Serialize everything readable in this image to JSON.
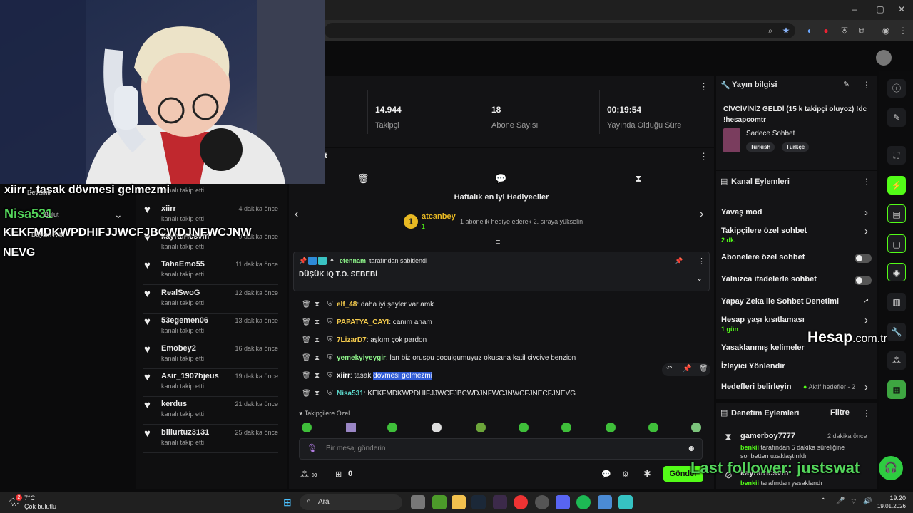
{
  "browser": {
    "window_controls": [
      "–",
      "▢",
      "✕"
    ],
    "ext_icons": [
      "zoom-icon",
      "star-icon",
      "ext-icon-1",
      "ext-icon-2",
      "shield-icon",
      "puzzle-icon",
      "profile-icon",
      "menu-icon"
    ]
  },
  "stats": [
    {
      "value": "14.944",
      "label": "Takipçi"
    },
    {
      "value": "18",
      "label": "Abone Sayısı"
    },
    {
      "value": "00:19:54",
      "label": "Yayında Olduğu Süre"
    }
  ],
  "chat_header": {
    "title_fragment": "et"
  },
  "top_gifters": {
    "title": "Haftalık en iyi Hediyeciler",
    "rank": "1",
    "name": "atcanbey",
    "count": "1",
    "hint": "1 abonelik hediye ederek 2. sıraya yükselin"
  },
  "pinned": {
    "by_user": "etennam",
    "by_text": "tarafından sabitlendi",
    "message": "DÜŞÜK IQ T.O. SEBEBİ"
  },
  "messages": [
    {
      "user": "elf_48",
      "color": "#f2c94c",
      "text": "daha iyi şeyler var amk"
    },
    {
      "user": "PAPATYA_CAYI",
      "color": "#f2c94c",
      "text": "canım anam"
    },
    {
      "user": "7LizarD7",
      "color": "#f2c94c",
      "text": "aşkım çok pardon"
    },
    {
      "user": "yemekyiyeygir",
      "color": "#8ef58a",
      "text": "lan biz oruspu cocuigumuyuz okusana katil civcive benzion"
    },
    {
      "user": "xiirr",
      "color": "#ffffff",
      "text": "tasak ",
      "highlight": "dövmesi gelmezmi"
    },
    {
      "user": "Nisa531",
      "color": "#5bd6c9",
      "text": "KEKFMDKWPDHIFJJWCFJBCWDJNFWCJNWCFJNECFJNEVG"
    }
  ],
  "followers_only": "Takipçilere Özel",
  "chat_input": {
    "placeholder": "Bir mesaj gönderin",
    "send": "Gönder",
    "points": "0"
  },
  "followers": [
    {
      "name": "xiirr",
      "sub": "kanalı takip etti",
      "time": "4 dakika önce"
    },
    {
      "name": "kayralricsvm",
      "sub": "kanalı takip etti",
      "time": "9 dakika önce"
    },
    {
      "name": "TahaEmo55",
      "sub": "kanalı takip etti",
      "time": "11 dakika önce"
    },
    {
      "name": "RealSwoG",
      "sub": "kanalı takip etti",
      "time": "12 dakika önce"
    },
    {
      "name": "53egemen06",
      "sub": "kanalı takip etti",
      "time": "13 dakika önce"
    },
    {
      "name": "Emobey2",
      "sub": "kanalı takip etti",
      "time": "16 dakika önce"
    },
    {
      "name": "Asir_1907bjeus",
      "sub": "kanalı takip etti",
      "time": "19 dakika önce"
    },
    {
      "name": "kerdus",
      "sub": "kanalı takip etti",
      "time": "21 dakika önce"
    },
    {
      "name": "billurtuz3131",
      "sub": "kanalı takip etti",
      "time": "25 dakika önce"
    }
  ],
  "follower_top": {
    "sub": "kanalı takip etti"
  },
  "stream_info": {
    "header": "Yayın bilgisi",
    "title": "CİVCİVİNİZ GELDİ (15 k takipçi oluyoz) !dc !hesapcomtr",
    "category": "Sadece Sohbet",
    "tags": [
      "Turkish",
      "Türkçe"
    ]
  },
  "channel_actions": {
    "header": "Kanal Eylemleri",
    "items": [
      {
        "label": "Yavaş mod"
      },
      {
        "label": "Takipçilere özel sohbet",
        "sub": "2 dk."
      },
      {
        "label": "Abonelere özel sohbet"
      },
      {
        "label": "Yalnızca ifadelerle sohbet"
      },
      {
        "label": "Yapay Zeka ile Sohbet Denetimi"
      },
      {
        "label": "Hesap yaşı kısıtlaması",
        "sub": "1 gün"
      },
      {
        "label": "Yasaklanmış kelimeler"
      },
      {
        "label": "İzleyici Yönlendir"
      },
      {
        "label": "Hedefleri belirleyin",
        "extra": "Aktif hedefler - 2"
      }
    ]
  },
  "moderation": {
    "header": "Denetim Eylemleri",
    "filter": "Filtre",
    "entries": [
      {
        "user": "gamerboy7777",
        "time": "2 dakika önce",
        "by": "benkii",
        "text": "tarafından 5 dakika süreliğine sohbetten uzaklaştırıldı"
      },
      {
        "user": "kayralricsvm",
        "by": "benkii",
        "text": "tarafından yasaklandı"
      }
    ]
  },
  "overlay": {
    "line1": "xiirr : tasak dövmesi gelmezmi",
    "line2": "Nisa531",
    "line3": "KEKFMDKWPDHIFJJWCFJBCWDJNFWCJNW",
    "line4": "NEVG",
    "ghost1": "Devamlı",
    "ghost2": "Bulut",
    "ghost3": "Daysın Kıbı",
    "last_follower": "Last follower: justswat",
    "brand": "Hesap",
    "brand_suffix": ".com.tr"
  },
  "taskbar": {
    "weather_temp": "7°C",
    "weather_text": "Çok bulutlu",
    "search": "Ara",
    "time": "19:20",
    "date": "19.01.2026",
    "badge": "2"
  }
}
